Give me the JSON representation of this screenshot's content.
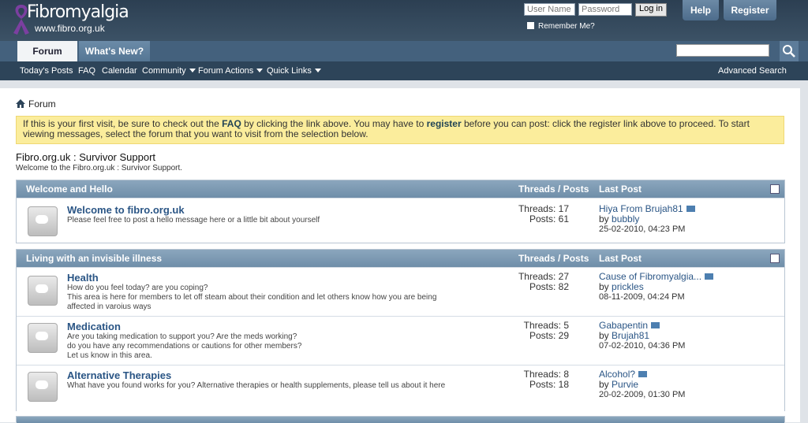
{
  "header": {
    "logo_title": "Fibromyalgia",
    "logo_url": "www.fibro.org.uk",
    "username_placeholder": "User Name",
    "password_placeholder": "Password",
    "login_label": "Log in",
    "remember_label": "Remember Me?",
    "help_label": "Help",
    "register_label": "Register"
  },
  "nav": {
    "tabs": [
      {
        "label": "Forum"
      },
      {
        "label": "What's New?"
      }
    ],
    "links": [
      {
        "label": "Today's Posts"
      },
      {
        "label": "FAQ"
      },
      {
        "label": "Calendar"
      },
      {
        "label": "Community"
      },
      {
        "label": "Forum Actions"
      },
      {
        "label": "Quick Links"
      }
    ],
    "advanced_search": "Advanced Search"
  },
  "breadcrumb": "Forum",
  "notice": {
    "part1": "If this is your first visit, be sure to check out the ",
    "faq": "FAQ",
    "part2": " by clicking the link above. You may have to ",
    "register": "register",
    "part3": " before you can post: click the register link above to proceed. To start viewing messages, select the forum that you want to visit from the selection below."
  },
  "page": {
    "title": "Fibro.org.uk : Survivor Support",
    "description": "Welcome to the Fibro.org.uk : Survivor Support."
  },
  "categories": [
    {
      "title": "Welcome and Hello",
      "threads_posts_header": "Threads / Posts",
      "last_post_header": "Last Post",
      "forums": [
        {
          "name": "Welcome to fibro.org.uk",
          "desc": "Please feel free to post a hello message here or a little bit about yourself",
          "threads": "Threads: 17",
          "posts": "Posts: 61",
          "last_title": "Hiya From Brujah81",
          "last_by": "by ",
          "last_user": "bubbly",
          "last_date": "25-02-2010, 04:23 PM"
        }
      ]
    },
    {
      "title": "Living with an invisible illness",
      "threads_posts_header": "Threads / Posts",
      "last_post_header": "Last Post",
      "forums": [
        {
          "name": "Health",
          "desc": "How do you feel today? are you coping?\nThis area is here for members to let off steam about their condition and let others know how you are being affected in varoius ways",
          "threads": "Threads: 27",
          "posts": "Posts: 82",
          "last_title": "Cause of Fibromyalgia...",
          "last_by": "by ",
          "last_user": "prickles",
          "last_date": "08-11-2009, 04:24 PM"
        },
        {
          "name": "Medication",
          "desc": "Are you taking medication to support you? Are the meds working?\ndo you have any recommendations or cautions for other members?\nLet us know in this area.",
          "threads": "Threads: 5",
          "posts": "Posts: 29",
          "last_title": "Gabapentin",
          "last_by": "by ",
          "last_user": "Brujah81",
          "last_date": "07-02-2010, 04:36 PM"
        },
        {
          "name": "Alternative Therapies",
          "desc": "What have you found works for you? Alternative therapies or health supplements, please tell us about it here",
          "threads": "Threads: 8",
          "posts": "Posts: 18",
          "last_title": "Alcohol?",
          "last_by": "by ",
          "last_user": "Purvie",
          "last_date": "20-02-2009, 01:30 PM"
        }
      ]
    }
  ]
}
